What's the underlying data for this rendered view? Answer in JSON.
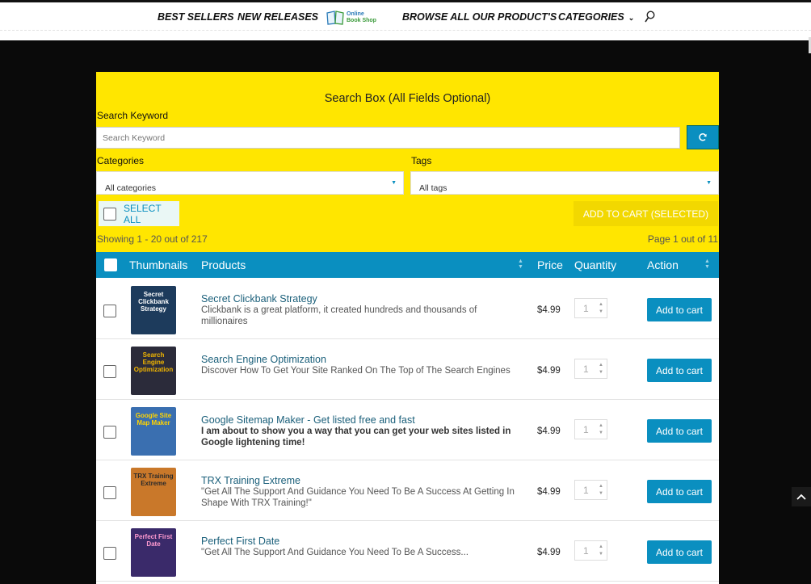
{
  "nav": {
    "best_sellers": "BEST SELLERS",
    "new_releases": "NEW RELEASES",
    "logo_line1": "Online",
    "logo_line2": "Book Shop",
    "browse_all": "BROWSE ALL OUR PRODUCT'S",
    "categories": "CATEGORIES"
  },
  "search": {
    "title": "Search Box (All Fields Optional)",
    "keyword_label": "Search Keyword",
    "keyword_placeholder": "Search Keyword",
    "categories_label": "Categories",
    "categories_value": "All categories",
    "tags_label": "Tags",
    "tags_value": "All tags",
    "select_all": "SELECT ALL",
    "add_selected": "ADD TO CART (SELECTED)",
    "showing": "Showing 1 - 20 out of 217",
    "page_info": "Page 1 out of 11"
  },
  "table": {
    "headers": {
      "thumbnails": "Thumbnails",
      "products": "Products",
      "price": "Price",
      "quantity": "Quantity",
      "action": "Action"
    },
    "rows": [
      {
        "thumb_text": "Secret Clickbank Strategy",
        "name": "Secret Clickbank Strategy",
        "description": "Clickbank is a great platform, it created hundreds and thousands of millionaires",
        "price": "$4.99",
        "qty": "1",
        "button": "Add to cart",
        "thumb_color": "#1d3b5c"
      },
      {
        "thumb_text": "Search Engine Optimization",
        "name": "Search Engine Optimization",
        "description": "Discover How To Get Your Site Ranked On The Top of The Search Engines",
        "price": "$4.99",
        "qty": "1",
        "button": "Add to cart",
        "thumb_color": "#2b2b3a"
      },
      {
        "thumb_text": "Google Site Map Maker",
        "name": "Google Sitemap Maker - Get listed free and fast",
        "description": "I am about to show you a way that you can get your web sites listed in Google lightening time!",
        "price": "$4.99",
        "qty": "1",
        "button": "Add to cart",
        "thumb_color": "#3a6fb0"
      },
      {
        "thumb_text": "TRX Training Extreme",
        "name": "TRX Training Extreme",
        "description": "\"Get All The Support And Guidance You Need To Be A Success At Getting In Shape With TRX Training!\"",
        "price": "$4.99",
        "qty": "1",
        "button": "Add to cart",
        "thumb_color": "#c9782a"
      },
      {
        "thumb_text": "Perfect First Date",
        "name": "Perfect First Date",
        "description": "\"Get All The Support And Guidance You Need To Be A Success...",
        "price": "$4.99",
        "qty": "1",
        "button": "Add to cart",
        "thumb_color": "#3a2a6a"
      }
    ]
  },
  "colors": {
    "accent": "#0a8fc0",
    "panel": "#ffe600",
    "background": "#0a0a0a"
  },
  "icons": [
    "search-icon",
    "refresh-icon",
    "chevron-down-icon",
    "caret-down-icon",
    "sort-icon",
    "arrow-up-icon",
    "book-logo-icon"
  ]
}
